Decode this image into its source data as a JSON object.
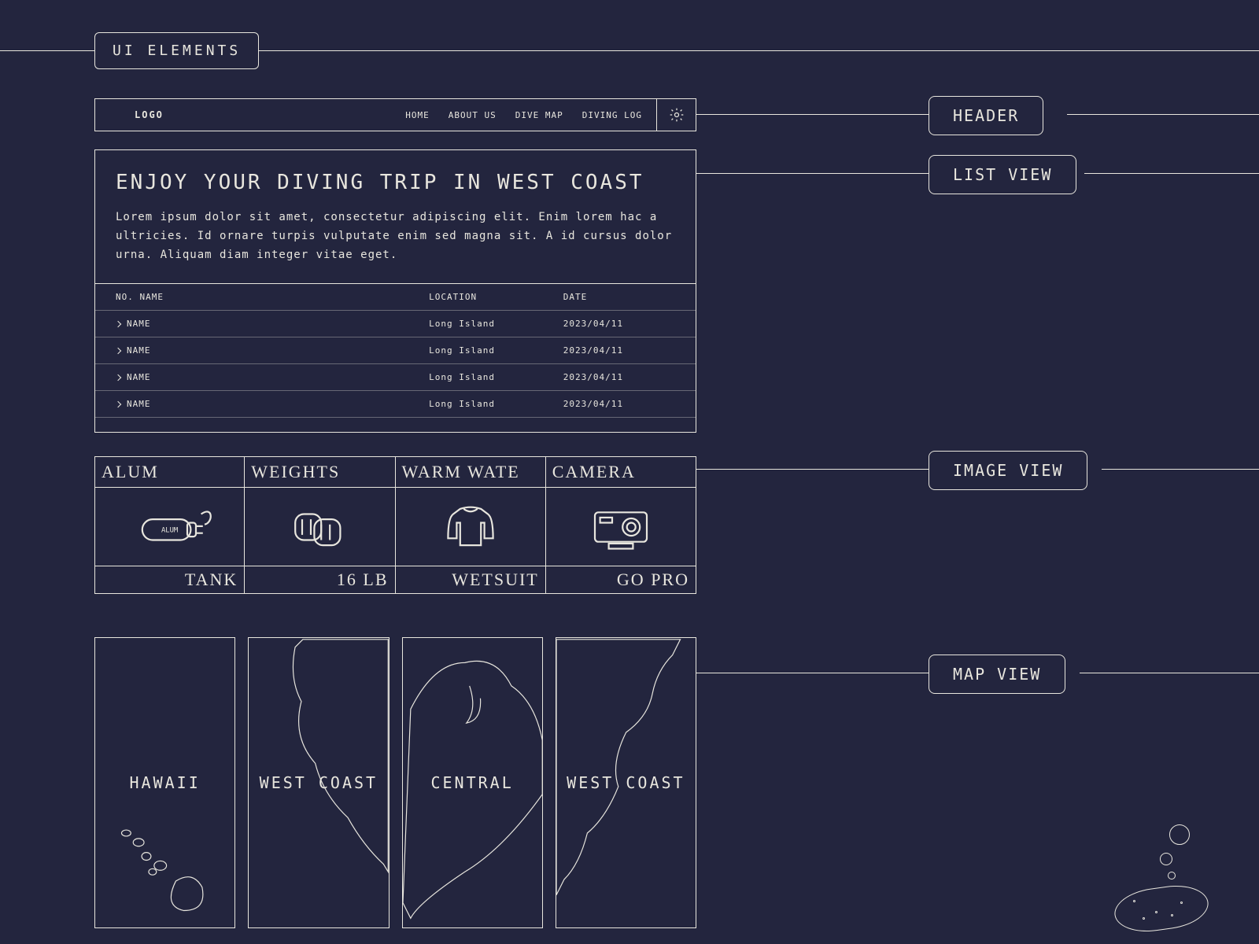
{
  "page_title_chip": "UI ELEMENTS",
  "labels": {
    "header": "HEADER",
    "list": "LIST VIEW",
    "image": "IMAGE VIEW",
    "map": "MAP VIEW"
  },
  "header": {
    "logo": "LOGO",
    "nav": [
      "HOME",
      "ABOUT US",
      "DIVE MAP",
      "DIVING LOG"
    ]
  },
  "list": {
    "title": "ENJOY YOUR DIVING TRIP IN WEST COAST",
    "body": "Lorem ipsum dolor sit amet, consectetur adipiscing elit. Enim lorem hac a ultricies. Id ornare turpis vulputate enim sed magna sit. A id cursus dolor urna. Aliquam diam integer vitae eget.",
    "columns": {
      "no_name": "NO. NAME",
      "location": "LOCATION",
      "date": "DATE"
    },
    "rows": [
      {
        "name": "NAME",
        "location": "Long Island",
        "date": "2023/04/11"
      },
      {
        "name": "NAME",
        "location": "Long Island",
        "date": "2023/04/11"
      },
      {
        "name": "NAME",
        "location": "Long Island",
        "date": "2023/04/11"
      },
      {
        "name": "NAME",
        "location": "Long Island",
        "date": "2023/04/11"
      }
    ]
  },
  "image_cards": [
    {
      "top": "ALUM",
      "bottom": "TANK"
    },
    {
      "top": "WEIGHTS",
      "bottom": "16 LB"
    },
    {
      "top": "WARM WATE",
      "bottom": "WETSUIT"
    },
    {
      "top": "CAMERA",
      "bottom": "GO PRO"
    }
  ],
  "map_cards": [
    "HAWAII",
    "WEST COAST",
    "CENTRAL",
    "WEST COAST"
  ]
}
